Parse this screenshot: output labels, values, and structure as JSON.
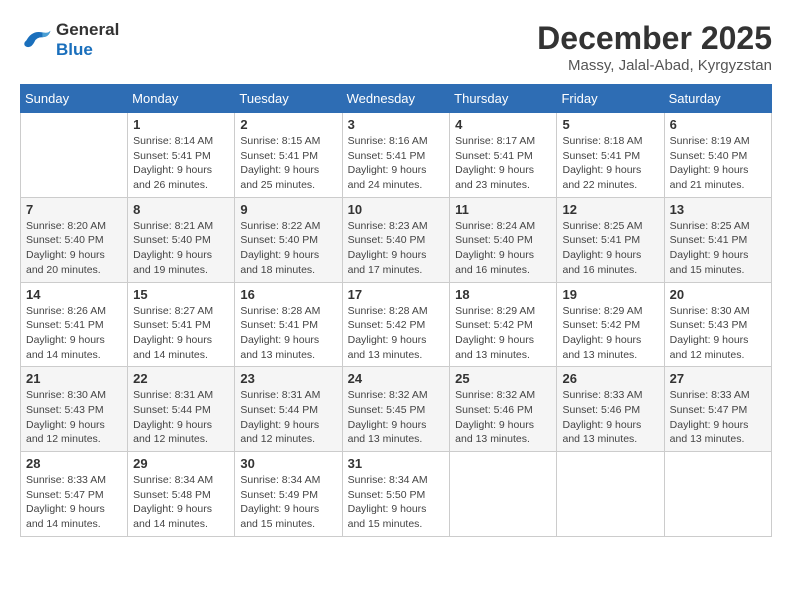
{
  "logo": {
    "line1": "General",
    "line2": "Blue"
  },
  "title": "December 2025",
  "location": "Massy, Jalal-Abad, Kyrgyzstan",
  "days_of_week": [
    "Sunday",
    "Monday",
    "Tuesday",
    "Wednesday",
    "Thursday",
    "Friday",
    "Saturday"
  ],
  "weeks": [
    [
      {
        "day": "",
        "info": ""
      },
      {
        "day": "1",
        "info": "Sunrise: 8:14 AM\nSunset: 5:41 PM\nDaylight: 9 hours\nand 26 minutes."
      },
      {
        "day": "2",
        "info": "Sunrise: 8:15 AM\nSunset: 5:41 PM\nDaylight: 9 hours\nand 25 minutes."
      },
      {
        "day": "3",
        "info": "Sunrise: 8:16 AM\nSunset: 5:41 PM\nDaylight: 9 hours\nand 24 minutes."
      },
      {
        "day": "4",
        "info": "Sunrise: 8:17 AM\nSunset: 5:41 PM\nDaylight: 9 hours\nand 23 minutes."
      },
      {
        "day": "5",
        "info": "Sunrise: 8:18 AM\nSunset: 5:41 PM\nDaylight: 9 hours\nand 22 minutes."
      },
      {
        "day": "6",
        "info": "Sunrise: 8:19 AM\nSunset: 5:40 PM\nDaylight: 9 hours\nand 21 minutes."
      }
    ],
    [
      {
        "day": "7",
        "info": "Sunrise: 8:20 AM\nSunset: 5:40 PM\nDaylight: 9 hours\nand 20 minutes."
      },
      {
        "day": "8",
        "info": "Sunrise: 8:21 AM\nSunset: 5:40 PM\nDaylight: 9 hours\nand 19 minutes."
      },
      {
        "day": "9",
        "info": "Sunrise: 8:22 AM\nSunset: 5:40 PM\nDaylight: 9 hours\nand 18 minutes."
      },
      {
        "day": "10",
        "info": "Sunrise: 8:23 AM\nSunset: 5:40 PM\nDaylight: 9 hours\nand 17 minutes."
      },
      {
        "day": "11",
        "info": "Sunrise: 8:24 AM\nSunset: 5:40 PM\nDaylight: 9 hours\nand 16 minutes."
      },
      {
        "day": "12",
        "info": "Sunrise: 8:25 AM\nSunset: 5:41 PM\nDaylight: 9 hours\nand 16 minutes."
      },
      {
        "day": "13",
        "info": "Sunrise: 8:25 AM\nSunset: 5:41 PM\nDaylight: 9 hours\nand 15 minutes."
      }
    ],
    [
      {
        "day": "14",
        "info": "Sunrise: 8:26 AM\nSunset: 5:41 PM\nDaylight: 9 hours\nand 14 minutes."
      },
      {
        "day": "15",
        "info": "Sunrise: 8:27 AM\nSunset: 5:41 PM\nDaylight: 9 hours\nand 14 minutes."
      },
      {
        "day": "16",
        "info": "Sunrise: 8:28 AM\nSunset: 5:41 PM\nDaylight: 9 hours\nand 13 minutes."
      },
      {
        "day": "17",
        "info": "Sunrise: 8:28 AM\nSunset: 5:42 PM\nDaylight: 9 hours\nand 13 minutes."
      },
      {
        "day": "18",
        "info": "Sunrise: 8:29 AM\nSunset: 5:42 PM\nDaylight: 9 hours\nand 13 minutes."
      },
      {
        "day": "19",
        "info": "Sunrise: 8:29 AM\nSunset: 5:42 PM\nDaylight: 9 hours\nand 13 minutes."
      },
      {
        "day": "20",
        "info": "Sunrise: 8:30 AM\nSunset: 5:43 PM\nDaylight: 9 hours\nand 12 minutes."
      }
    ],
    [
      {
        "day": "21",
        "info": "Sunrise: 8:30 AM\nSunset: 5:43 PM\nDaylight: 9 hours\nand 12 minutes."
      },
      {
        "day": "22",
        "info": "Sunrise: 8:31 AM\nSunset: 5:44 PM\nDaylight: 9 hours\nand 12 minutes."
      },
      {
        "day": "23",
        "info": "Sunrise: 8:31 AM\nSunset: 5:44 PM\nDaylight: 9 hours\nand 12 minutes."
      },
      {
        "day": "24",
        "info": "Sunrise: 8:32 AM\nSunset: 5:45 PM\nDaylight: 9 hours\nand 13 minutes."
      },
      {
        "day": "25",
        "info": "Sunrise: 8:32 AM\nSunset: 5:46 PM\nDaylight: 9 hours\nand 13 minutes."
      },
      {
        "day": "26",
        "info": "Sunrise: 8:33 AM\nSunset: 5:46 PM\nDaylight: 9 hours\nand 13 minutes."
      },
      {
        "day": "27",
        "info": "Sunrise: 8:33 AM\nSunset: 5:47 PM\nDaylight: 9 hours\nand 13 minutes."
      }
    ],
    [
      {
        "day": "28",
        "info": "Sunrise: 8:33 AM\nSunset: 5:47 PM\nDaylight: 9 hours\nand 14 minutes."
      },
      {
        "day": "29",
        "info": "Sunrise: 8:34 AM\nSunset: 5:48 PM\nDaylight: 9 hours\nand 14 minutes."
      },
      {
        "day": "30",
        "info": "Sunrise: 8:34 AM\nSunset: 5:49 PM\nDaylight: 9 hours\nand 15 minutes."
      },
      {
        "day": "31",
        "info": "Sunrise: 8:34 AM\nSunset: 5:50 PM\nDaylight: 9 hours\nand 15 minutes."
      },
      {
        "day": "",
        "info": ""
      },
      {
        "day": "",
        "info": ""
      },
      {
        "day": "",
        "info": ""
      }
    ]
  ]
}
